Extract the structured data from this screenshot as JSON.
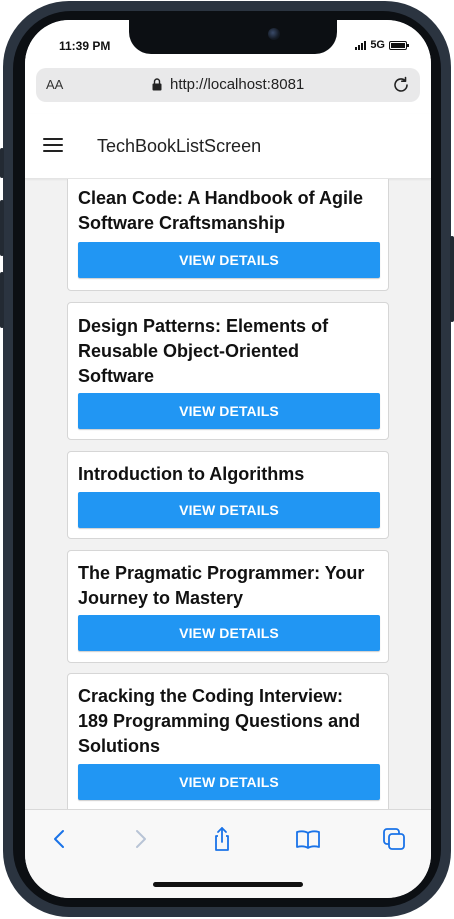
{
  "status_bar": {
    "time": "11:39 PM",
    "network": "5G"
  },
  "browser": {
    "text_size_label": "AA",
    "url": "http://localhost:8081"
  },
  "header": {
    "title": "TechBookListScreen"
  },
  "books": [
    {
      "title": "Clean Code: A Handbook of Agile Software Craftsmanship",
      "button_label": "VIEW DETAILS"
    },
    {
      "title": "Design Patterns: Elements of Reusable Object-Oriented Software",
      "button_label": "VIEW DETAILS"
    },
    {
      "title": "Introduction to Algorithms",
      "button_label": "VIEW DETAILS"
    },
    {
      "title": "The Pragmatic Programmer: Your Journey to Mastery",
      "button_label": "VIEW DETAILS"
    },
    {
      "title": "Cracking the Coding Interview: 189 Programming Questions and Solutions",
      "button_label": "VIEW DETAILS"
    }
  ],
  "toolbar": {
    "icons": [
      "back-icon",
      "forward-icon",
      "share-icon",
      "bookmarks-icon",
      "tabs-icon"
    ]
  },
  "colors": {
    "accent": "#2196f3",
    "list_background": "#f2f2f2",
    "card_background": "#ffffff",
    "toolbar_icon": "#1a73e8",
    "toolbar_icon_disabled": "#b8c4d6"
  }
}
